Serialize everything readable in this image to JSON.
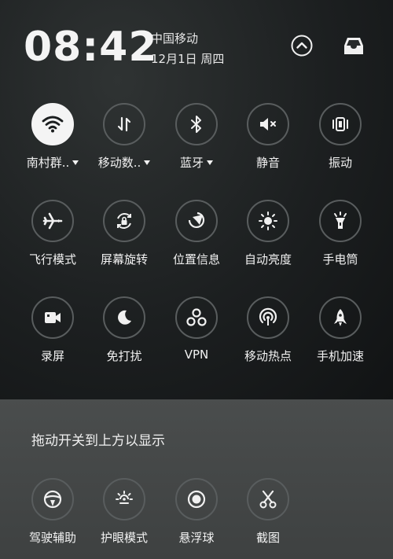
{
  "status": {
    "time": "08:42",
    "carrier": "中国移动",
    "date": "12月1日 周四"
  },
  "header_buttons": {
    "collapse_icon": "chevron-up-icon",
    "tray_icon": "inbox-tray-icon"
  },
  "toggles": [
    {
      "label": "南村群..",
      "icon": "wifi-icon",
      "active": true,
      "has_dropdown": true
    },
    {
      "label": "移动数..",
      "icon": "mobile-data-icon",
      "active": false,
      "has_dropdown": true
    },
    {
      "label": "蓝牙",
      "icon": "bluetooth-icon",
      "active": false,
      "has_dropdown": true
    },
    {
      "label": "静音",
      "icon": "mute-icon",
      "active": false,
      "has_dropdown": false
    },
    {
      "label": "振动",
      "icon": "vibrate-icon",
      "active": false,
      "has_dropdown": false
    },
    {
      "label": "飞行模式",
      "icon": "airplane-icon",
      "active": false,
      "has_dropdown": false
    },
    {
      "label": "屏幕旋转",
      "icon": "rotation-lock-icon",
      "active": false,
      "has_dropdown": false
    },
    {
      "label": "位置信息",
      "icon": "location-icon",
      "active": false,
      "has_dropdown": false
    },
    {
      "label": "自动亮度",
      "icon": "brightness-icon",
      "active": false,
      "has_dropdown": false
    },
    {
      "label": "手电筒",
      "icon": "flashlight-icon",
      "active": false,
      "has_dropdown": false
    },
    {
      "label": "录屏",
      "icon": "screen-record-icon",
      "active": false,
      "has_dropdown": false
    },
    {
      "label": "免打扰",
      "icon": "moon-icon",
      "active": false,
      "has_dropdown": false
    },
    {
      "label": "VPN",
      "icon": "vpn-icon",
      "active": false,
      "has_dropdown": false
    },
    {
      "label": "移动热点",
      "icon": "hotspot-icon",
      "active": false,
      "has_dropdown": false
    },
    {
      "label": "手机加速",
      "icon": "rocket-icon",
      "active": false,
      "has_dropdown": false
    }
  ],
  "drag_hint": "拖动开关到上方以显示",
  "extra_toggles": [
    {
      "label": "驾驶辅助",
      "icon": "steering-wheel-icon"
    },
    {
      "label": "护眼模式",
      "icon": "eye-care-icon"
    },
    {
      "label": "悬浮球",
      "icon": "floating-ball-icon"
    },
    {
      "label": "截图",
      "icon": "scissors-icon"
    }
  ],
  "colors": {
    "active_circle": "#f4f4f4",
    "circle_border": "#595d5e",
    "top_background": "#1c1f20",
    "bottom_background": "#434646"
  }
}
